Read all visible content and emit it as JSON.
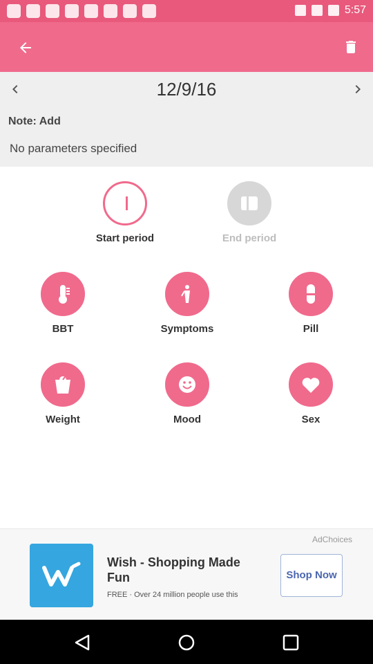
{
  "status_bar": {
    "time": "5:57"
  },
  "app_bar": {
    "back_icon": "arrow-back-icon",
    "delete_icon": "trash-icon"
  },
  "date_bar": {
    "prev_icon": "chevron-left-icon",
    "next_icon": "chevron-right-icon",
    "date": "12/9/16",
    "note": "Note: Add",
    "parameters": "No parameters specified"
  },
  "period": {
    "start_label": "Start period",
    "end_label": "End period"
  },
  "options_row1": [
    {
      "label": "BBT",
      "icon": "thermometer-icon"
    },
    {
      "label": "Symptoms",
      "icon": "person-icon"
    },
    {
      "label": "Pill",
      "icon": "pill-icon"
    }
  ],
  "options_row2": [
    {
      "label": "Weight",
      "icon": "scale-icon"
    },
    {
      "label": "Mood",
      "icon": "smile-icon"
    },
    {
      "label": "Sex",
      "icon": "heart-icon"
    }
  ],
  "ad": {
    "adchoices": "AdChoices",
    "title": "Wish - Shopping Made Fun",
    "subtitle": "FREE · Over 24 million people use this",
    "cta": "Shop Now"
  },
  "nav": {
    "back": "nav-back-icon",
    "home": "nav-home-icon",
    "recents": "nav-recents-icon"
  },
  "colors": {
    "accent": "#f06a8c",
    "status_bar": "#e8597c",
    "inactive": "#d7d7d7",
    "ad_blue": "#35a6df"
  }
}
